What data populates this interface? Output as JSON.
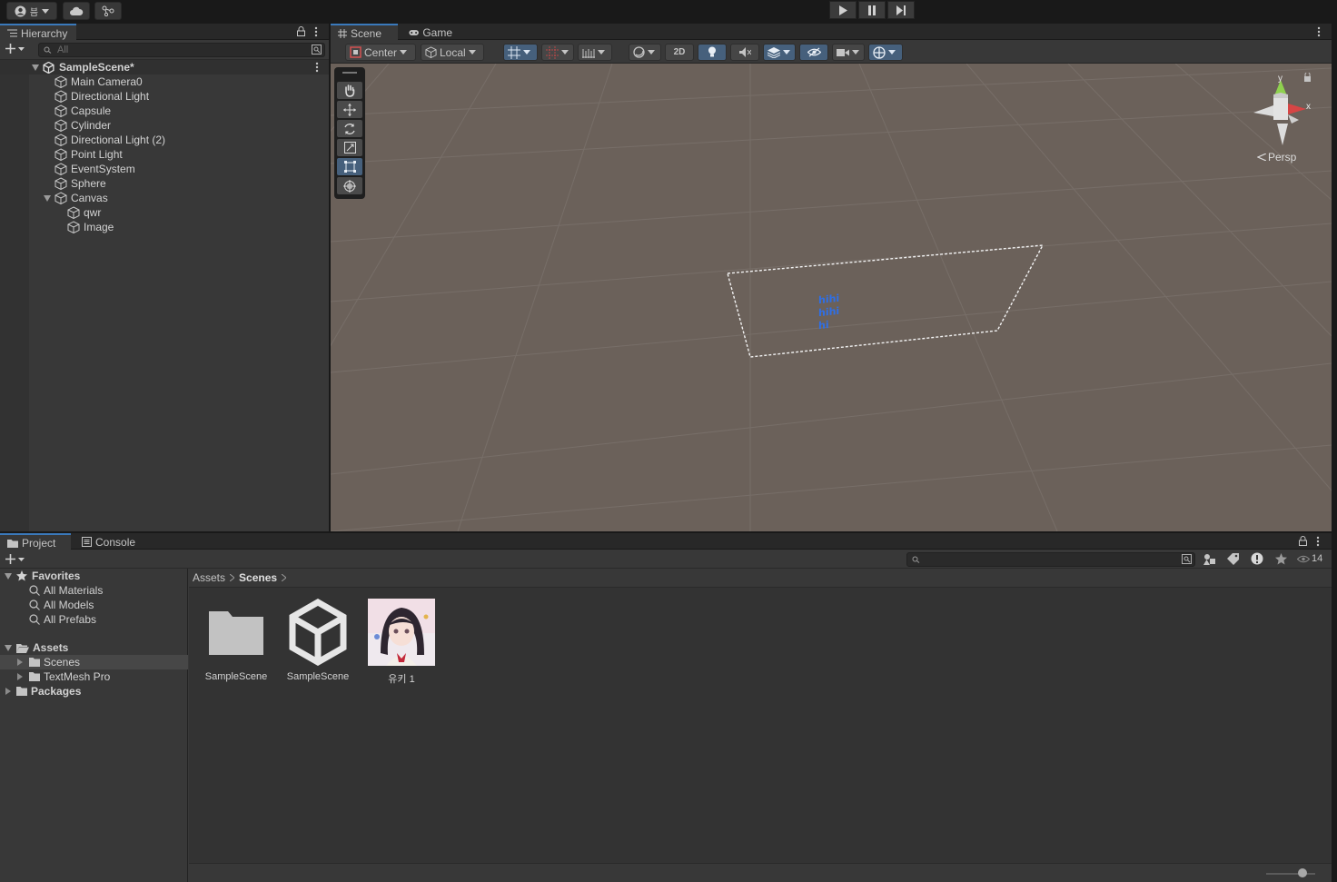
{
  "toolbar": {
    "account_icon": "account-icon",
    "account_label": "븜",
    "cloud_icon": "cloud-icon",
    "collab_icon": "collab-icon",
    "play_icon": "play-icon",
    "pause_icon": "pause-icon",
    "step_icon": "step-icon"
  },
  "hierarchy": {
    "tab_label": "Hierarchy",
    "search_placeholder": "All",
    "scene_name": "SampleScene*",
    "items": [
      {
        "label": "Main Camera0",
        "depth": 1
      },
      {
        "label": "Directional Light",
        "depth": 1
      },
      {
        "label": "Capsule",
        "depth": 1
      },
      {
        "label": "Cylinder",
        "depth": 1
      },
      {
        "label": "Directional Light (2)",
        "depth": 1
      },
      {
        "label": "Point Light",
        "depth": 1
      },
      {
        "label": "EventSystem",
        "depth": 1
      },
      {
        "label": "Sphere",
        "depth": 1
      },
      {
        "label": "Canvas",
        "depth": 1,
        "expanded": true
      },
      {
        "label": "qwr",
        "depth": 2
      },
      {
        "label": "Image",
        "depth": 2
      }
    ]
  },
  "scene": {
    "tabs": [
      {
        "label": "Scene",
        "icon": "grid-icon",
        "active": true
      },
      {
        "label": "Game",
        "icon": "gamepad-icon",
        "active": false
      }
    ],
    "pivot_label": "Center",
    "space_label": "Local",
    "mode_2d_label": "2D",
    "gizmo_axis_y": "y",
    "gizmo_axis_x": "x",
    "persp_label": "Persp",
    "canvas_text_lines": [
      "hihi",
      "hihi",
      "hi"
    ],
    "canvas_text_color": "#2f6fe6"
  },
  "project": {
    "tabs": [
      {
        "label": "Project",
        "icon": "folder-icon",
        "active": true
      },
      {
        "label": "Console",
        "icon": "console-icon",
        "active": false
      }
    ],
    "hidden_count": "14",
    "favorites": {
      "label": "Favorites",
      "items": [
        "All Materials",
        "All Models",
        "All Prefabs"
      ]
    },
    "assets_root": "Assets",
    "asset_folders": [
      "Scenes",
      "TextMesh Pro"
    ],
    "packages_label": "Packages",
    "breadcrumb": [
      "Assets",
      "Scenes"
    ],
    "assets": [
      {
        "label": "SampleScene",
        "kind": "folder"
      },
      {
        "label": "SampleScene",
        "kind": "unity-scene"
      },
      {
        "label": "유키 1",
        "kind": "image"
      }
    ]
  },
  "colors": {
    "accent": "#3a79bb",
    "selection": "#46607c",
    "scene_bg": "#6b615a",
    "panel_bg": "#383838"
  }
}
